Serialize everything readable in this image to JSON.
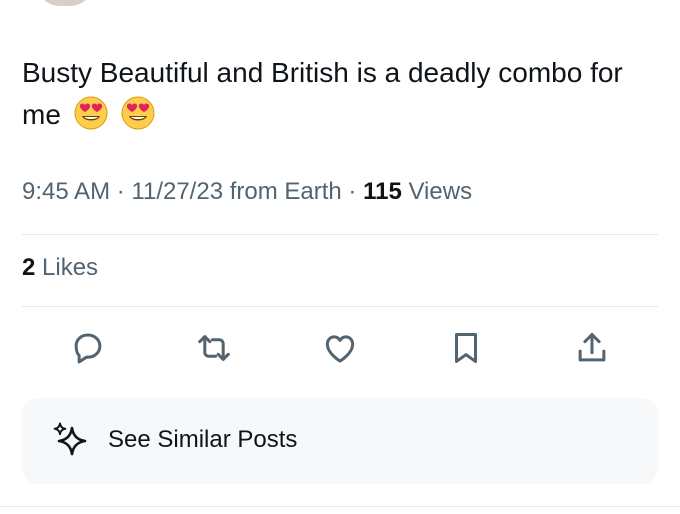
{
  "tweet": {
    "text": "Busty Beautiful and British is a deadly combo for me",
    "emojis": [
      "heart-eyes-emoji",
      "heart-eyes-emoji"
    ]
  },
  "meta": {
    "time": "9:45 AM",
    "sep1": "·",
    "date": "11/27/23",
    "source": "from Earth",
    "sep2": "·",
    "views_count": "115",
    "views_label": "Views"
  },
  "engagement": {
    "likes_count": "2",
    "likes_label": "Likes"
  },
  "actions": [
    {
      "icon": "reply-icon"
    },
    {
      "icon": "retweet-icon"
    },
    {
      "icon": "heart-icon"
    },
    {
      "icon": "bookmark-icon"
    },
    {
      "icon": "share-icon"
    }
  ],
  "similar": {
    "label": "See Similar Posts",
    "icon": "sparkle-icon"
  },
  "colors": {
    "text": "#0f1419",
    "secondary": "#536471",
    "divider": "#e6e9eb",
    "card_bg": "#f7f8f9"
  }
}
